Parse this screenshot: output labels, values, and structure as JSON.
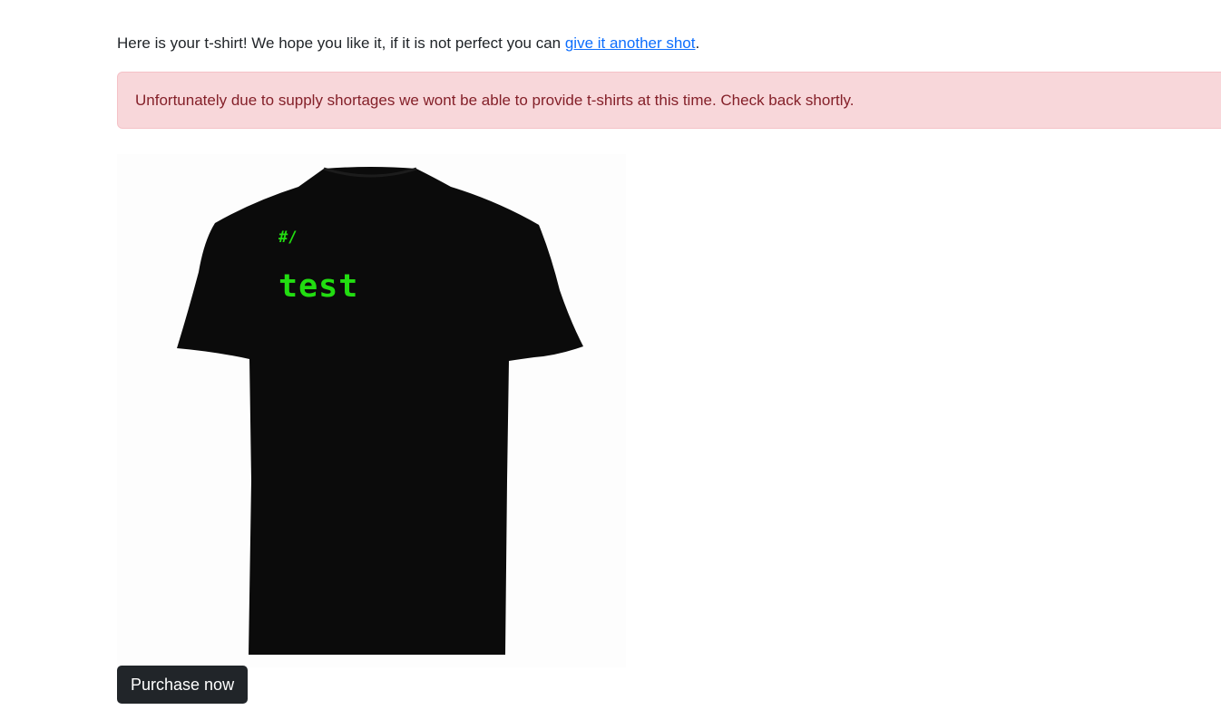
{
  "intro": {
    "text_before": "Here is your t-shirt! We hope you like it, if it is not perfect you can ",
    "link_label": "give it another shot",
    "text_after": "."
  },
  "alert": {
    "message": "Unfortunately due to supply shortages we wont be able to provide t-shirts at this time. Check back shortly."
  },
  "shirt": {
    "prefix_text": "#/",
    "print_text": "test",
    "shirt_color": "#0b0b0b",
    "print_color": "#22dd11"
  },
  "actions": {
    "purchase_label": "Purchase now"
  },
  "colors": {
    "alert_bg": "#f8d7da",
    "alert_text": "#842029",
    "link": "#0d6efd",
    "button_bg": "#212529"
  }
}
